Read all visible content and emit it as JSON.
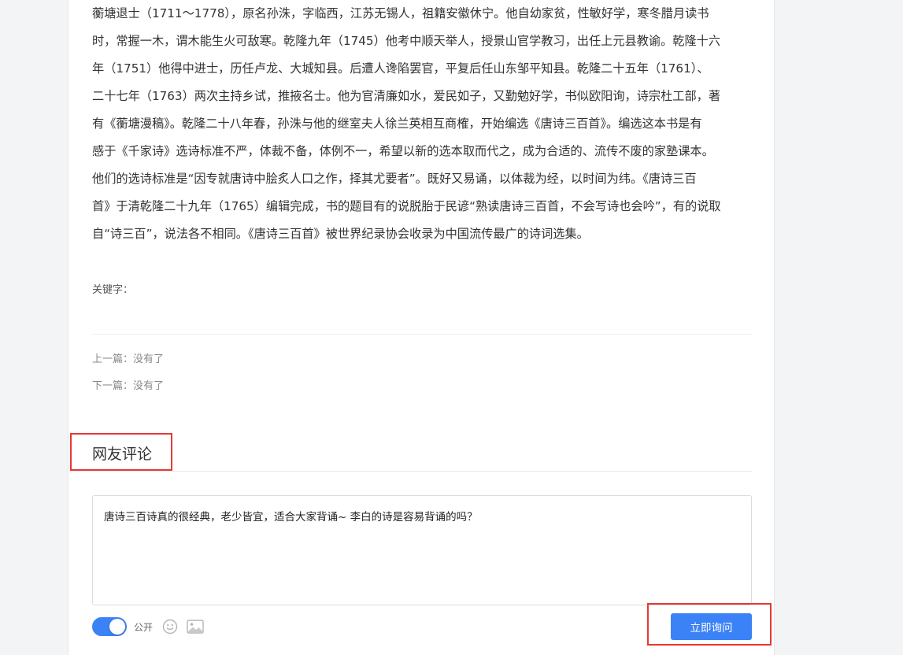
{
  "article": {
    "lines": [
      "蘅塘退士（1711～1778），原名孙洙，字临西，江苏无锡人，祖籍安徽休宁。他自幼家贫，性敏好学，寒冬腊月读书",
      "时，常握一木，谓木能生火可敌寒。乾隆九年（1745）他考中顺天举人，授景山官学教习，出任上元县教谕。乾隆十六",
      "年（1751）他得中进士，历任卢龙、大城知县。后遭人谗陷罢官，平复后任山东邹平知县。乾隆二十五年（1761）、",
      "二十七年（1763）两次主持乡试，推掖名士。他为官清廉如水，爱民如子，又勤勉好学，书似欧阳询，诗宗杜工部，著",
      "有《蘅塘漫稿》。乾隆二十八年春，孙洙与他的继室夫人徐兰英相互商榷，开始编选《唐诗三百首》。编选这本书是有",
      "感于《千家诗》选诗标准不严，体裁不备，体例不一，希望以新的选本取而代之，成为合适的、流传不废的家塾课本。",
      "他们的选诗标准是“因专就唐诗中脍炙人口之作，择其尤要者”。既好又易诵，以体裁为经，以时间为纬。《唐诗三百",
      "首》于清乾隆二十九年（1765）编辑完成，书的题目有的说脱胎于民谚“熟读唐诗三百首，不会写诗也会吟”，有的说取",
      "自“诗三百”，说法各不相同。《唐诗三百首》被世界纪录协会收录为中国流传最广的诗词选集。"
    ]
  },
  "keywords_label": "关键字：",
  "nav": {
    "prev": "上一篇：没有了",
    "next": "下一篇：没有了"
  },
  "comments": {
    "title": "网友评论",
    "input_value": "唐诗三百诗真的很经典，老少皆宜，适合大家背诵~ 李白的诗是容易背诵的吗？",
    "public_label": "公开",
    "submit_label": "立即询问",
    "toggle_on": true
  },
  "colors": {
    "accent": "#3b82f6",
    "highlight": "#e53935"
  },
  "icons": [
    "emoji-icon",
    "image-icon"
  ]
}
